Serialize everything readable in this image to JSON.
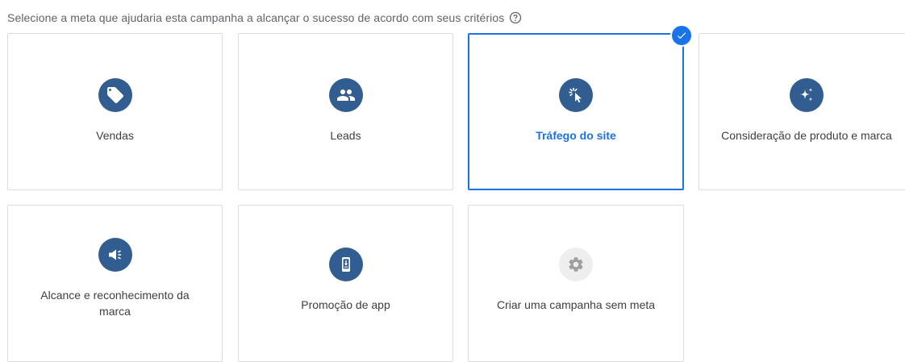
{
  "header": {
    "prompt": "Selecione a meta que ajudaria esta campanha a alcançar o sucesso de acordo com seus critérios"
  },
  "goals": {
    "vendas": {
      "label": "Vendas",
      "icon": "tag-icon"
    },
    "leads": {
      "label": "Leads",
      "icon": "people-icon"
    },
    "trafego": {
      "label": "Tráfego do site",
      "icon": "cursor-click-icon",
      "selected": true
    },
    "consideracao": {
      "label": "Consideração de produto e marca",
      "icon": "sparkle-icon"
    },
    "alcance": {
      "label_line1": "Alcance e reconhecimento da",
      "label_line2": "marca",
      "icon": "megaphone-icon"
    },
    "app": {
      "label": "Promoção de app",
      "icon": "phone-download-icon"
    },
    "sem_meta": {
      "label": "Criar uma campanha sem meta",
      "icon": "gear-icon"
    }
  },
  "colors": {
    "icon_bg": "#315d91",
    "selected": "#1a73e8",
    "border": "#dadce0",
    "disabled_icon_bg": "#eeeeee"
  }
}
